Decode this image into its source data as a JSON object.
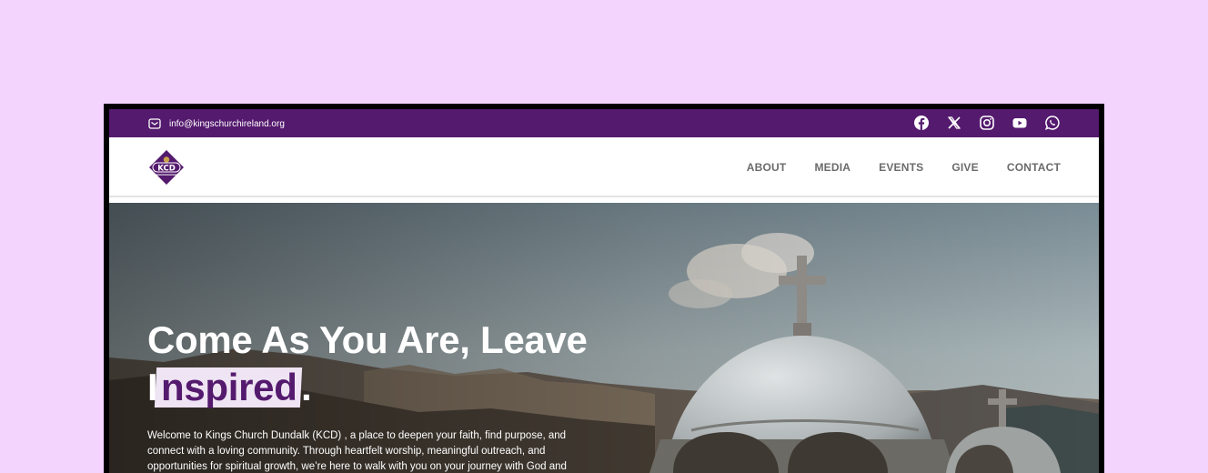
{
  "topbar": {
    "email": "info@kingschurchireland.org",
    "social": [
      "facebook-icon",
      "x-icon",
      "instagram-icon",
      "youtube-icon",
      "whatsapp-icon"
    ]
  },
  "brand": {
    "logo_text": "KCD"
  },
  "nav": {
    "items": [
      "ABOUT",
      "MEDIA",
      "EVENTS",
      "GIVE",
      "CONTACT"
    ]
  },
  "hero": {
    "headline_line1": "Come As You Are, Leave",
    "headline_prefix": "I",
    "headline_highlight": "nspired",
    "headline_suffix": ".",
    "intro": "Welcome to Kings Church Dundalk (KCD) , a place to deepen your faith, find purpose, and connect with a loving community. Through heartfelt worship, meaningful outreach, and opportunities for spiritual growth, we’re here to walk with you on your journey with God and"
  },
  "colors": {
    "brand_purple": "#541a6e",
    "page_bg": "#f2d4fd",
    "highlight_bg": "#efe4f3"
  }
}
